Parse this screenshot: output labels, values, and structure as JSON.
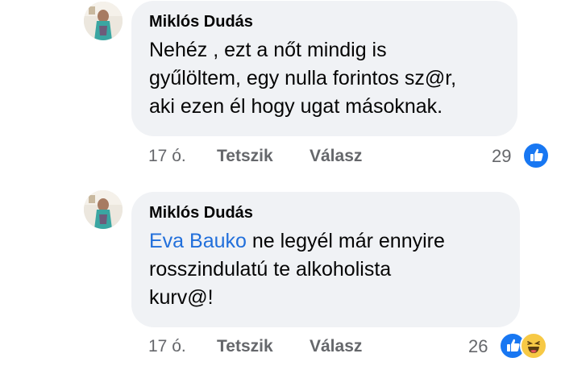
{
  "comments": [
    {
      "author": "Miklós Dudás",
      "text": "Nehéz , ezt a nőt mindig is\ngyűlöltem, egy nulla forintos sz@r,\naki ezen él hogy ugat másoknak.",
      "time": "17 ó.",
      "like_label": "Tetszik",
      "reply_label": "Válasz",
      "reaction_count": "29",
      "reactions": [
        "like-icon"
      ]
    },
    {
      "author": "Miklós Dudás",
      "mention": "Eva Bauko",
      "text": " ne legyél már ennyire\nrosszindulatú te alkoholista\nkurv@!",
      "time": "17 ó.",
      "like_label": "Tetszik",
      "reply_label": "Válasz",
      "reaction_count": "26",
      "reactions": [
        "like-icon",
        "haha-icon"
      ]
    }
  ],
  "colors": {
    "bubble": "#f0f2f5",
    "mention": "#216fdb",
    "like": "#1877f2",
    "haha": "#f7c945",
    "meta": "#65676b"
  }
}
